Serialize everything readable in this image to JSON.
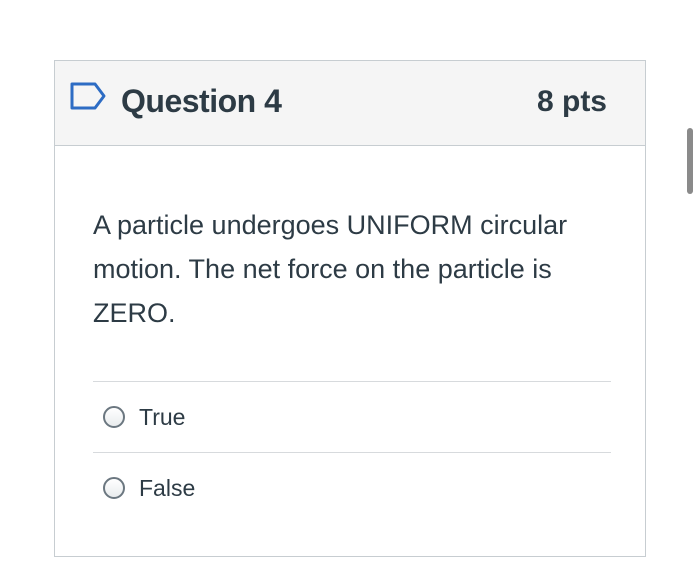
{
  "question": {
    "title": "Question 4",
    "points": "8 pts",
    "flag_icon": "bookmark-flag-icon",
    "text": "A particle undergoes UNIFORM circular motion. The net force on the particle is ZERO.",
    "answers": [
      {
        "label": "True",
        "selected": false
      },
      {
        "label": "False",
        "selected": false
      }
    ]
  },
  "colors": {
    "text": "#2d3b45",
    "header_bg": "#f5f5f5",
    "border": "#c7cdd1",
    "flag": "#2d6cc4"
  }
}
